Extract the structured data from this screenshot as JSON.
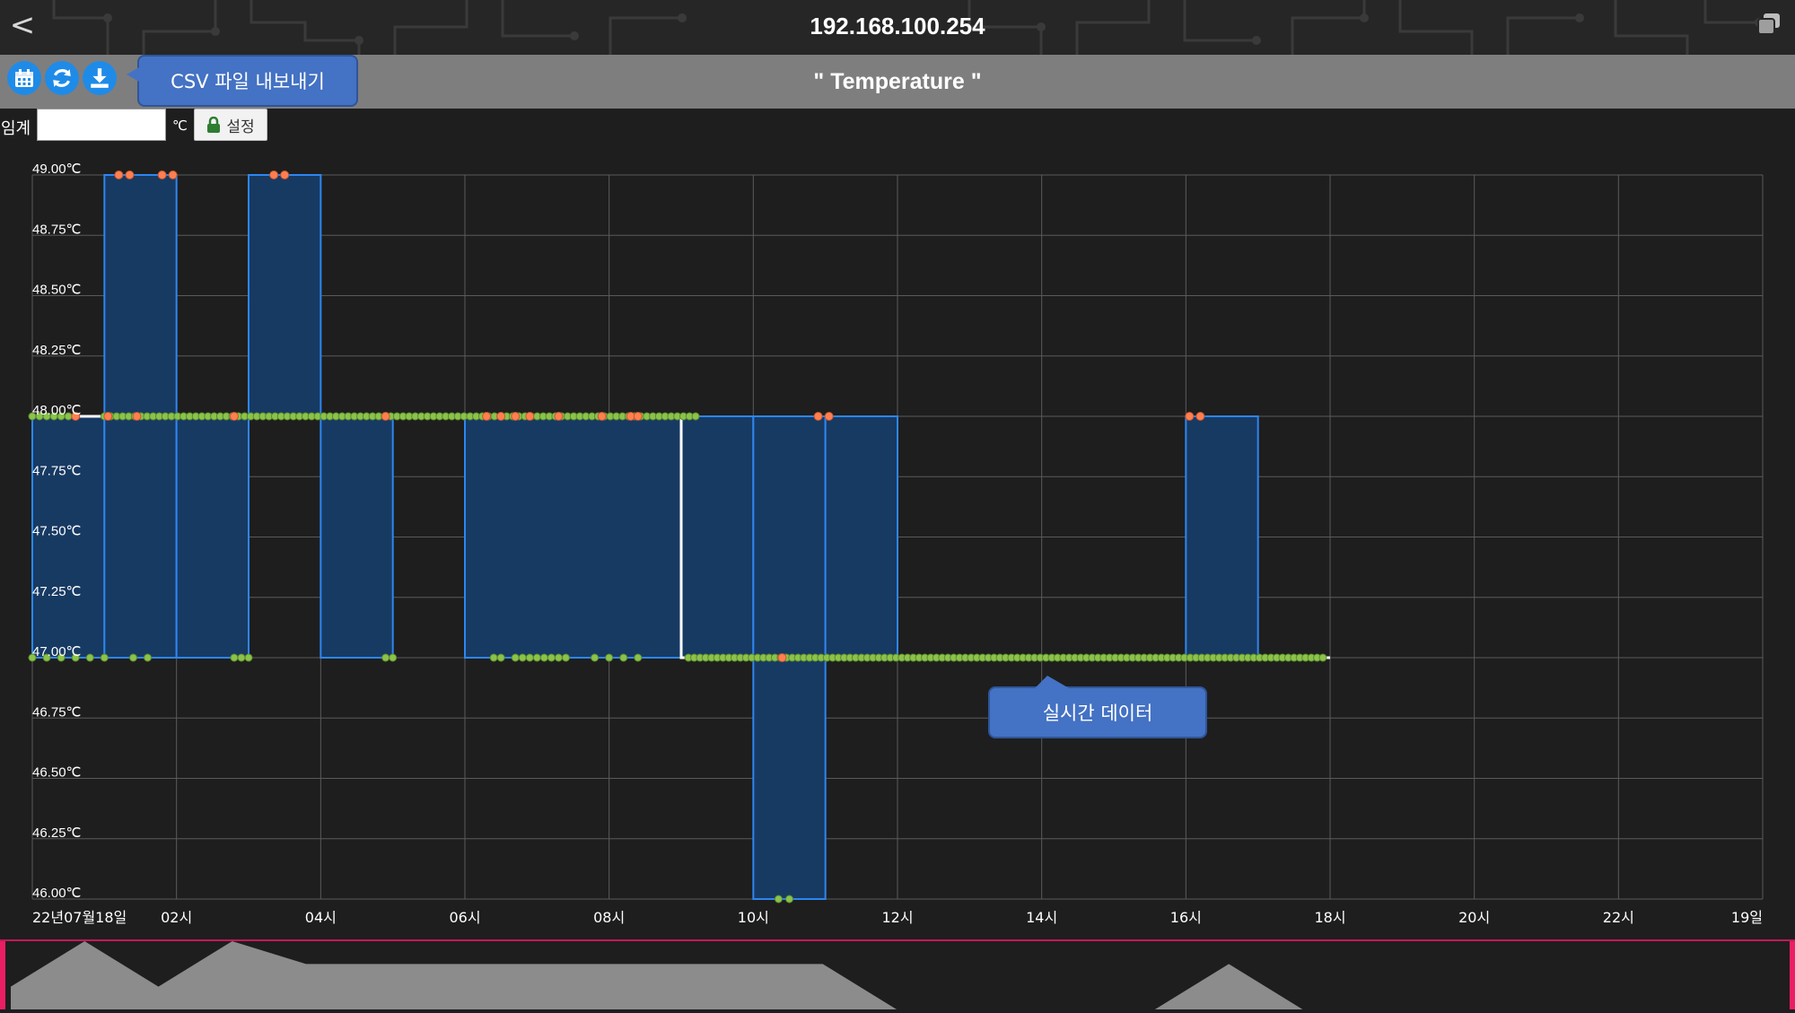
{
  "header": {
    "back_icon": "back-chevron-icon",
    "host": "192.168.100.254",
    "window_icon": "restore-window-icon"
  },
  "toolbar": {
    "chart_title": "\" Temperature \"",
    "buttons": [
      {
        "name": "calendar-button",
        "icon": "calendar-icon"
      },
      {
        "name": "refresh-button",
        "icon": "refresh-icon"
      },
      {
        "name": "download-button",
        "icon": "download-icon"
      }
    ],
    "csv_tooltip": "CSV 파일 내보내기"
  },
  "threshold": {
    "label": "임계",
    "value": "",
    "unit": "℃",
    "set_label": "설정",
    "lock_icon": "lock-icon"
  },
  "live_tooltip": "실시간 데이터",
  "colors": {
    "background": "#1e1e1e",
    "bar_fill": "#173a63",
    "bar_stroke": "#2e86f0",
    "point_green": "#8bc34a",
    "point_orange": "#ff7f50",
    "live_line": "#ffffff",
    "navigator_accent": "#e91e63",
    "button": "#1f8be8"
  },
  "chart_data": {
    "type": "bar",
    "title": "\" Temperature \"",
    "xlabel": "",
    "ylabel": "",
    "ylim": [
      46.0,
      49.0
    ],
    "y_ticks": [
      "46.00℃",
      "46.25℃",
      "46.50℃",
      "46.75℃",
      "47.00℃",
      "47.25℃",
      "47.50℃",
      "47.75℃",
      "48.00℃",
      "48.25℃",
      "48.50℃",
      "48.75℃",
      "49.00℃"
    ],
    "xlim_hours": [
      0,
      24
    ],
    "x_ticks": [
      {
        "hour": 0,
        "label": "22년07월18일"
      },
      {
        "hour": 2,
        "label": "02시"
      },
      {
        "hour": 4,
        "label": "04시"
      },
      {
        "hour": 6,
        "label": "06시"
      },
      {
        "hour": 8,
        "label": "08시"
      },
      {
        "hour": 10,
        "label": "10시"
      },
      {
        "hour": 12,
        "label": "12시"
      },
      {
        "hour": 14,
        "label": "14시"
      },
      {
        "hour": 16,
        "label": "16시"
      },
      {
        "hour": 18,
        "label": "18시"
      },
      {
        "hour": 20,
        "label": "20시"
      },
      {
        "hour": 22,
        "label": "22시"
      },
      {
        "hour": 24,
        "label": "19일"
      }
    ],
    "bars": [
      {
        "start": 0.0,
        "end": 1.0,
        "low": 47.0,
        "high": 48.0
      },
      {
        "start": 1.0,
        "end": 2.0,
        "low": 47.0,
        "high": 49.0
      },
      {
        "start": 2.0,
        "end": 3.0,
        "low": 47.0,
        "high": 48.0
      },
      {
        "start": 3.0,
        "end": 4.0,
        "low": 48.0,
        "high": 49.0
      },
      {
        "start": 4.0,
        "end": 5.0,
        "low": 47.0,
        "high": 48.0
      },
      {
        "start": 6.0,
        "end": 9.0,
        "low": 47.0,
        "high": 48.0
      },
      {
        "start": 9.0,
        "end": 10.0,
        "low": 47.0,
        "high": 48.0
      },
      {
        "start": 10.0,
        "end": 11.0,
        "low": 46.0,
        "high": 48.0
      },
      {
        "start": 11.0,
        "end": 12.0,
        "low": 47.0,
        "high": 48.0
      },
      {
        "start": 16.0,
        "end": 17.0,
        "low": 47.0,
        "high": 48.0
      }
    ],
    "live_series": [
      {
        "hour": 0.0,
        "value": 48.0
      },
      {
        "hour": 9.0,
        "value": 48.0
      },
      {
        "hour": 9.0,
        "value": 47.0
      },
      {
        "hour": 18.0,
        "value": 47.0
      }
    ],
    "points_green": [
      {
        "from": 0.0,
        "to": 0.6,
        "value": 48.0,
        "count": 7
      },
      {
        "from": 1.0,
        "to": 9.2,
        "value": 48.0,
        "count": 98
      },
      {
        "from": 0.0,
        "to": 1.0,
        "value": 47.0,
        "count": 6
      },
      {
        "from": 1.4,
        "to": 1.6,
        "value": 47.0,
        "count": 2
      },
      {
        "from": 2.8,
        "to": 3.0,
        "value": 47.0,
        "count": 3
      },
      {
        "from": 4.9,
        "to": 5.0,
        "value": 47.0,
        "count": 2
      },
      {
        "from": 6.4,
        "to": 6.5,
        "value": 47.0,
        "count": 2
      },
      {
        "from": 6.7,
        "to": 7.4,
        "value": 47.0,
        "count": 8
      },
      {
        "from": 7.8,
        "to": 8.4,
        "value": 47.0,
        "count": 4
      },
      {
        "from": 9.1,
        "to": 17.9,
        "value": 47.0,
        "count": 111
      },
      {
        "from": 10.35,
        "to": 10.5,
        "value": 46.0,
        "count": 2
      }
    ],
    "points_orange": [
      {
        "hour": 0.6,
        "value": 48.0
      },
      {
        "hour": 1.05,
        "value": 48.0
      },
      {
        "hour": 1.45,
        "value": 48.0
      },
      {
        "hour": 2.8,
        "value": 48.0
      },
      {
        "hour": 4.9,
        "value": 48.0
      },
      {
        "hour": 6.3,
        "value": 48.0
      },
      {
        "hour": 6.5,
        "value": 48.0
      },
      {
        "hour": 6.7,
        "value": 48.0
      },
      {
        "hour": 6.9,
        "value": 48.0
      },
      {
        "hour": 7.3,
        "value": 48.0
      },
      {
        "hour": 7.9,
        "value": 48.0
      },
      {
        "hour": 8.3,
        "value": 48.0
      },
      {
        "hour": 8.4,
        "value": 48.0
      },
      {
        "hour": 10.9,
        "value": 48.0
      },
      {
        "hour": 11.05,
        "value": 48.0
      },
      {
        "hour": 16.05,
        "value": 48.0
      },
      {
        "hour": 16.2,
        "value": 48.0
      },
      {
        "hour": 1.2,
        "value": 49.0
      },
      {
        "hour": 1.35,
        "value": 49.0
      },
      {
        "hour": 1.8,
        "value": 49.0
      },
      {
        "hour": 1.95,
        "value": 49.0
      },
      {
        "hour": 3.35,
        "value": 49.0
      },
      {
        "hour": 3.5,
        "value": 49.0
      },
      {
        "hour": 10.4,
        "value": 47.0
      }
    ],
    "grid": true,
    "legend": "none",
    "navigator": {
      "profile": [
        {
          "hour": 0.0,
          "value": 47.0
        },
        {
          "hour": 1.0,
          "value": 49.0
        },
        {
          "hour": 2.0,
          "value": 47.0
        },
        {
          "hour": 3.0,
          "value": 49.0
        },
        {
          "hour": 4.0,
          "value": 48.0
        },
        {
          "hour": 11.0,
          "value": 48.0
        },
        {
          "hour": 12.0,
          "value": 46.0
        },
        {
          "hour": 15.5,
          "value": 46.0
        },
        {
          "hour": 16.5,
          "value": 48.0
        },
        {
          "hour": 17.5,
          "value": 46.0
        }
      ]
    }
  }
}
